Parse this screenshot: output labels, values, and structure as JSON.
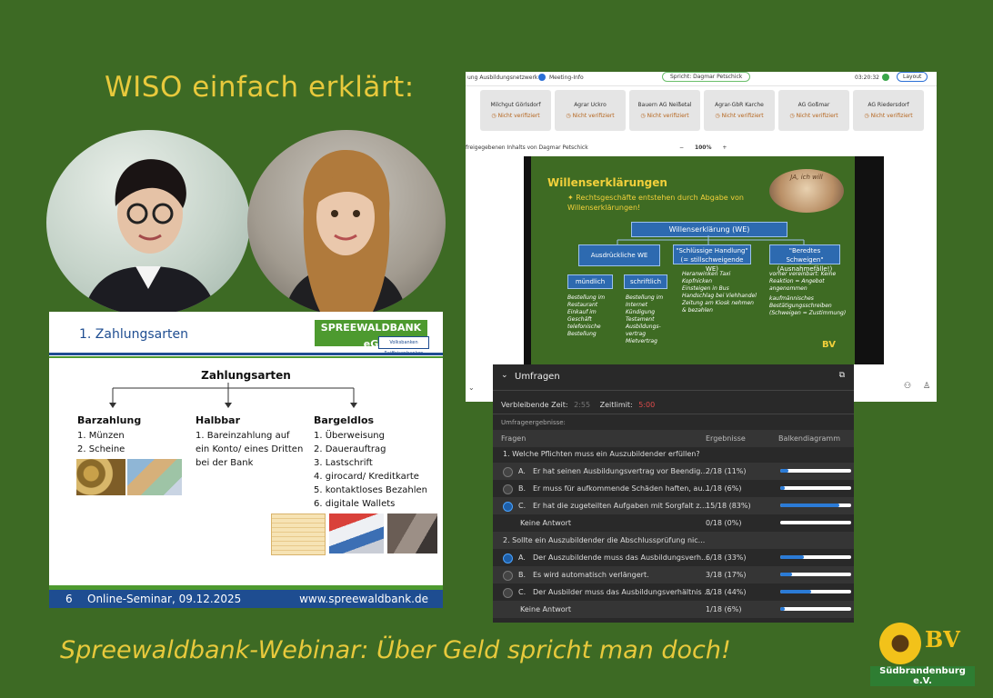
{
  "page": {
    "title": "WISO einfach erklärt:",
    "footer_title": "Spreewaldbank-Webinar: Über Geld spricht man doch!"
  },
  "slide_zahlungsarten": {
    "heading": "1. Zahlungsarten",
    "bank_name": "SPREEWALDBANK eG",
    "bank_sub": "Volksbanken Raiffeisenbanken",
    "center_title": "Zahlungsarten",
    "columns": [
      {
        "title": "Barzahlung",
        "items": [
          "1. Münzen",
          "2. Scheine"
        ]
      },
      {
        "title": "Halbbar",
        "items": [
          "1. Bareinzahlung auf",
          "ein Konto/ eines Dritten",
          "bei der Bank"
        ]
      },
      {
        "title": "Bargeldlos",
        "items": [
          "1. Überweisung",
          "2. Dauerauftrag",
          "3. Lastschrift",
          "4. girocard/ Kreditkarte",
          "5. kontaktloses Bezahlen",
          "6. digitale Wallets"
        ]
      }
    ],
    "footer_page": "6",
    "footer_event": "Online-Seminar, 09.12.2025",
    "footer_url": "www.spreewaldbank.de"
  },
  "meeting": {
    "network": "ung Ausbildungsnetzwerk",
    "meeting_info": "Meeting-Info",
    "speaker": "Spricht: Dagmar Petschick",
    "time": "03:20:32",
    "layout": "Layout",
    "tiles": [
      {
        "name": "Milchgut Görlsdorf",
        "status": "Nicht verifiziert"
      },
      {
        "name": "Agrar Uckro",
        "status": "Nicht verifiziert"
      },
      {
        "name": "Bauern AG Neißetal",
        "status": "Nicht verifiziert"
      },
      {
        "name": "Agrar-GbR Karche",
        "status": "Nicht verifiziert"
      },
      {
        "name": "AG Goßmar",
        "status": "Nicht verifiziert"
      },
      {
        "name": "AG Riedersdorf",
        "status": "Nicht verifiziert"
      }
    ],
    "shared_label": "freigegebenen Inhalts von Dagmar Petschick",
    "zoom": "100%",
    "zoom_minus": "−",
    "zoom_plus": "+"
  },
  "willens_slide": {
    "title": "Willenserklärungen",
    "subtitle": "Rechtsgeschäfte entstehen durch Abgabe von Willenserklärungen!",
    "ja_label": "JA, ich will",
    "root": "Willenserklärung (WE)",
    "branch_express": "Ausdrückliche WE",
    "branch_implicit": "\"Schlüssige Handlung\" (= stillschweigende WE)",
    "branch_silence": "\"Beredtes Schweigen\" (Ausnahmefälle!)",
    "oral": "mündlich",
    "written": "schriftlich",
    "oral_items": [
      "Bestellung im Restaurant",
      "Einkauf im Geschäft",
      "telefonische Bestellung"
    ],
    "written_items": [
      "Bestellung im Internet",
      "Kündigung",
      "Testament",
      "Ausbildungs-vertrag",
      "Mietvertrag"
    ],
    "implicit_items": [
      "Heranwinken Taxi",
      "Kopfnicken",
      "Einsteigen in Bus",
      "Handschlag bei Viehhandel",
      "Zeitung am Kiosk nehmen & bezahlen"
    ],
    "silence_items": [
      "vorher vereinbart: Keine Reaktion = Angebot angenommen",
      "kaufmännisches Bestätigungsschreiben (Schweigen = Zustimmung)"
    ],
    "logo": "BV"
  },
  "polls": {
    "title": "Umfragen",
    "remaining_label": "Verbleibende Zeit:",
    "remaining_value": "2:55",
    "limit_label": "Zeitlimit:",
    "limit_value": "5:00",
    "results_label": "Umfrageergebnisse:",
    "col_questions": "Fragen",
    "col_results": "Ergebnisse",
    "col_bar": "Balkendiagramm",
    "questions": [
      {
        "text": "1.  Welche Pflichten muss ein Auszubildender erfüllen?",
        "answers": [
          {
            "letter": "A.",
            "text": "Er hat seinen Ausbildungsvertrag vor Beendig...",
            "result": "2/18 (11%)",
            "pct": 11,
            "selected": false
          },
          {
            "letter": "B.",
            "text": "Er muss für aufkommende Schäden haften, au...",
            "result": "1/18 (6%)",
            "pct": 6,
            "selected": false
          },
          {
            "letter": "C.",
            "text": "Er hat die zugeteilten Aufgaben mit Sorgfalt z...",
            "result": "15/18 (83%)",
            "pct": 83,
            "selected": true
          },
          {
            "letter": "",
            "text": "Keine Antwort",
            "result": "0/18 (0%)",
            "pct": 0,
            "selected": false
          }
        ]
      },
      {
        "text": "2.  Sollte ein Auszubildender die Abschlussprüfung nic...",
        "answers": [
          {
            "letter": "A.",
            "text": "Der Auszubildende muss das Ausbildungsverh...",
            "result": "6/18 (33%)",
            "pct": 33,
            "selected": true
          },
          {
            "letter": "B.",
            "text": "Es wird automatisch verlängert.",
            "result": "3/18 (17%)",
            "pct": 17,
            "selected": false
          },
          {
            "letter": "C.",
            "text": "Der Ausbilder muss das Ausbildungsverhältnis ...",
            "result": "8/18 (44%)",
            "pct": 44,
            "selected": false
          },
          {
            "letter": "",
            "text": "Keine Antwort",
            "result": "1/18 (6%)",
            "pct": 6,
            "selected": false
          }
        ]
      }
    ]
  },
  "logo": {
    "letters": "BV",
    "text": "Südbrandenburg e.V."
  }
}
